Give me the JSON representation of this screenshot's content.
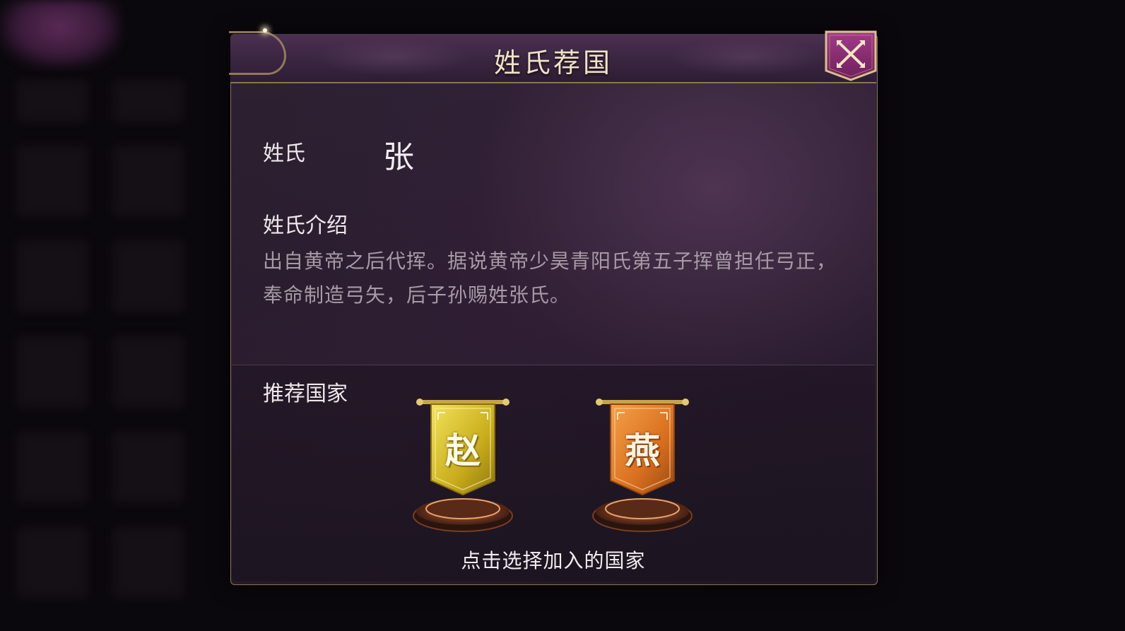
{
  "dialog": {
    "title": "姓氏荐国"
  },
  "surname": {
    "label": "姓氏",
    "value": "张"
  },
  "intro": {
    "heading": "姓氏介绍",
    "text": "出自黄帝之后代挥。据说黄帝少昊青阳氏第五子挥曾担任弓正，奉命制造弓矢，后子孙赐姓张氏。"
  },
  "recommend": {
    "heading": "推荐国家",
    "countries": [
      {
        "name": "赵",
        "color": "#d9c02a"
      },
      {
        "name": "燕",
        "color": "#e07a22"
      }
    ],
    "hint": "点击选择加入的国家"
  },
  "icons": {
    "close": "close-x-icon",
    "banner": "flag-banner-icon",
    "pedestal": "pedestal-icon"
  }
}
